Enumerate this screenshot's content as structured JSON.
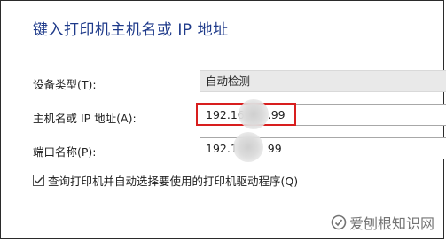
{
  "dialog": {
    "title": "键入打印机主机名或 IP 地址"
  },
  "form": {
    "device_type": {
      "label": "设备类型(T):",
      "value": "自动检测"
    },
    "hostname": {
      "label": "主机名或 IP 地址(A):",
      "value": "192.16███.99"
    },
    "port_name": {
      "label": "端口名称(P):",
      "value": "192.16███99"
    },
    "query_driver": {
      "label": "查询打印机并自动选择要使用的打印机驱动程序(Q)",
      "checked": true
    }
  },
  "watermark": {
    "text": "爱刨根知识网"
  },
  "colors": {
    "title": "#1e3a8a",
    "highlight_border": "#d81e1e",
    "select_bg": "#e9e9e9"
  }
}
